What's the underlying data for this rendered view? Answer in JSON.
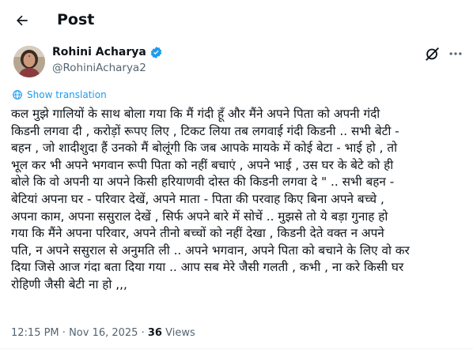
{
  "header": {
    "title": "Post",
    "back_icon": "arrow-left-icon"
  },
  "author": {
    "name": "Rohini Acharya",
    "handle": "@RohiniAcharya2",
    "verified_color": "#1d9bf0"
  },
  "actions": {
    "grok_icon": "grok-icon",
    "more_icon": "more-horizontal-icon"
  },
  "translate": {
    "label": "Show translation",
    "icon": "globe-icon",
    "color": "#1d9bf0"
  },
  "post": {
    "text": "कल मुझे गालियों के साथ बोला गया कि मैं गंदी हूँ और मैंने अपने  पिता को अपनी गंदी\nकिडनी लगवा दी , करोड़ों रूपए लिए , टिकट लिया तब लगवाई गंदी किडनी .. सभी बेटी -\nबहन , जो शादीशुदा हैं उनको मैं बोलूंगी कि जब आपके मायके में कोई बेटा - भाई हो , तो\nभूल कर भी अपने भगवान रूपी पिता को नहीं बचाएं , अपने भाई , उस घर के बेटे को ही\nबोले कि वो अपनी या अपने किसी हरियाणवी  दोस्त की किडनी लगवा दे \" .. सभी बहन -\nबेटियां अपना घर - परिवार देखें, अपने माता - पिता की परवाह किए बिना अपने बच्चे ,\nअपना काम, अपना ससुराल देखें , सिर्फ अपने बारे में सोचें ..  मुझसे तो ये बड़ा गुनाह हो\nगया कि मैंने अपना परिवार, अपने तीनो बच्चों को नहीं देखा , किडनी देते वक्त न अपने\nपति, न अपने ससुराल से अनुमति ली .. अपने भगवान, अपने पिता को बचाने के लिए वो कर\nदिया जिसे आज गंदा बता दिया गया .. आप सब मेरे जैसी गलती , कभी , ना करे किसी घर\nरोहिणी जैसी बेटी ना हो ,,,"
  },
  "meta": {
    "time": "12:15 PM",
    "sep1": " · ",
    "date": "Nov 16, 2025",
    "sep2": " · ",
    "views_count": "36",
    "views_label": " Views"
  }
}
